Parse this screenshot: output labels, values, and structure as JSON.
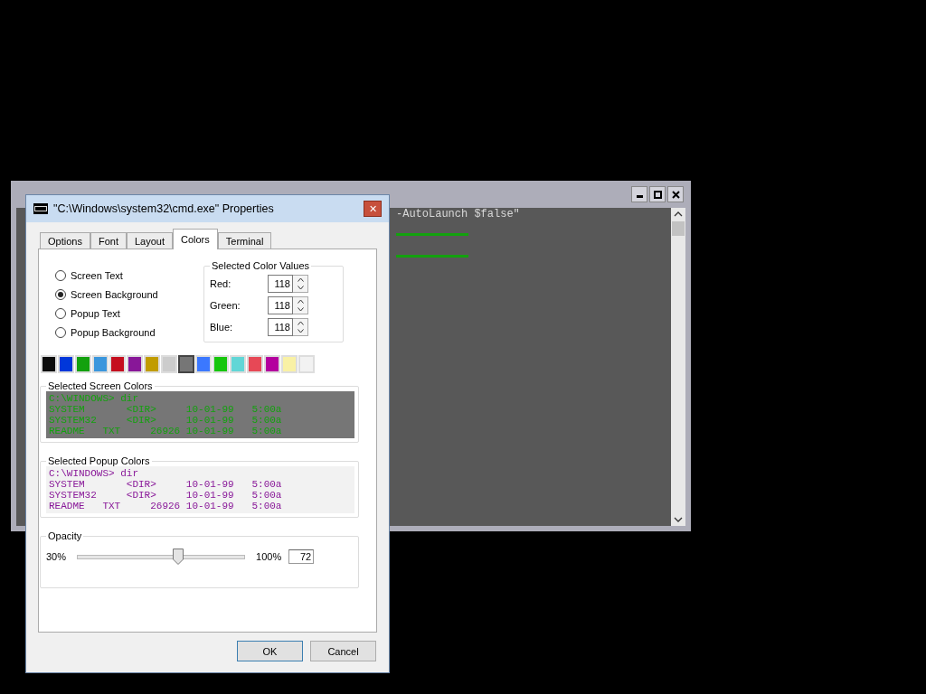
{
  "console": {
    "text": "-AutoLaunch $false\""
  },
  "dialog": {
    "title": "\"C:\\Windows\\system32\\cmd.exe\" Properties",
    "close": "✕"
  },
  "tabs": [
    {
      "label": "Options",
      "selected": false
    },
    {
      "label": "Font",
      "selected": false
    },
    {
      "label": "Layout",
      "selected": false
    },
    {
      "label": "Colors",
      "selected": true
    },
    {
      "label": "Terminal",
      "selected": false
    }
  ],
  "targets": [
    {
      "label": "Screen Text",
      "selected": false
    },
    {
      "label": "Screen Background",
      "selected": true
    },
    {
      "label": "Popup Text",
      "selected": false
    },
    {
      "label": "Popup Background",
      "selected": false
    }
  ],
  "color_values": {
    "title": "Selected Color Values",
    "fields": [
      {
        "label": "Red:",
        "value": "118"
      },
      {
        "label": "Green:",
        "value": "118"
      },
      {
        "label": "Blue:",
        "value": "118"
      }
    ]
  },
  "palette": [
    {
      "color": "#0c0c0c",
      "selected": false
    },
    {
      "color": "#0037da",
      "selected": false
    },
    {
      "color": "#13a10e",
      "selected": false
    },
    {
      "color": "#3a96dd",
      "selected": false
    },
    {
      "color": "#c50f1f",
      "selected": false
    },
    {
      "color": "#881798",
      "selected": false
    },
    {
      "color": "#c19c00",
      "selected": false
    },
    {
      "color": "#cccccc",
      "selected": false
    },
    {
      "color": "#767676",
      "selected": true
    },
    {
      "color": "#3b78ff",
      "selected": false
    },
    {
      "color": "#16c60c",
      "selected": false
    },
    {
      "color": "#61d6d6",
      "selected": false
    },
    {
      "color": "#e74856",
      "selected": false
    },
    {
      "color": "#b4009e",
      "selected": false
    },
    {
      "color": "#f9f1a5",
      "selected": false
    },
    {
      "color": "#f2f2f2",
      "selected": false
    }
  ],
  "screen_preview": {
    "title": "Selected Screen Colors",
    "lines": [
      "C:\\WINDOWS> dir",
      "SYSTEM       <DIR>     10-01-99   5:00a",
      "SYSTEM32     <DIR>     10-01-99   5:00a",
      "README   TXT     26926 10-01-99   5:00a"
    ]
  },
  "popup_preview": {
    "title": "Selected Popup Colors",
    "lines": [
      "C:\\WINDOWS> dir",
      "SYSTEM       <DIR>     10-01-99   5:00a",
      "SYSTEM32     <DIR>     10-01-99   5:00a",
      "README   TXT     26926 10-01-99   5:00a"
    ]
  },
  "opacity": {
    "title": "Opacity",
    "min_label": "30%",
    "max_label": "100%",
    "level": 0.6,
    "value": "72"
  },
  "buttons": [
    "OK",
    "Cancel"
  ]
}
